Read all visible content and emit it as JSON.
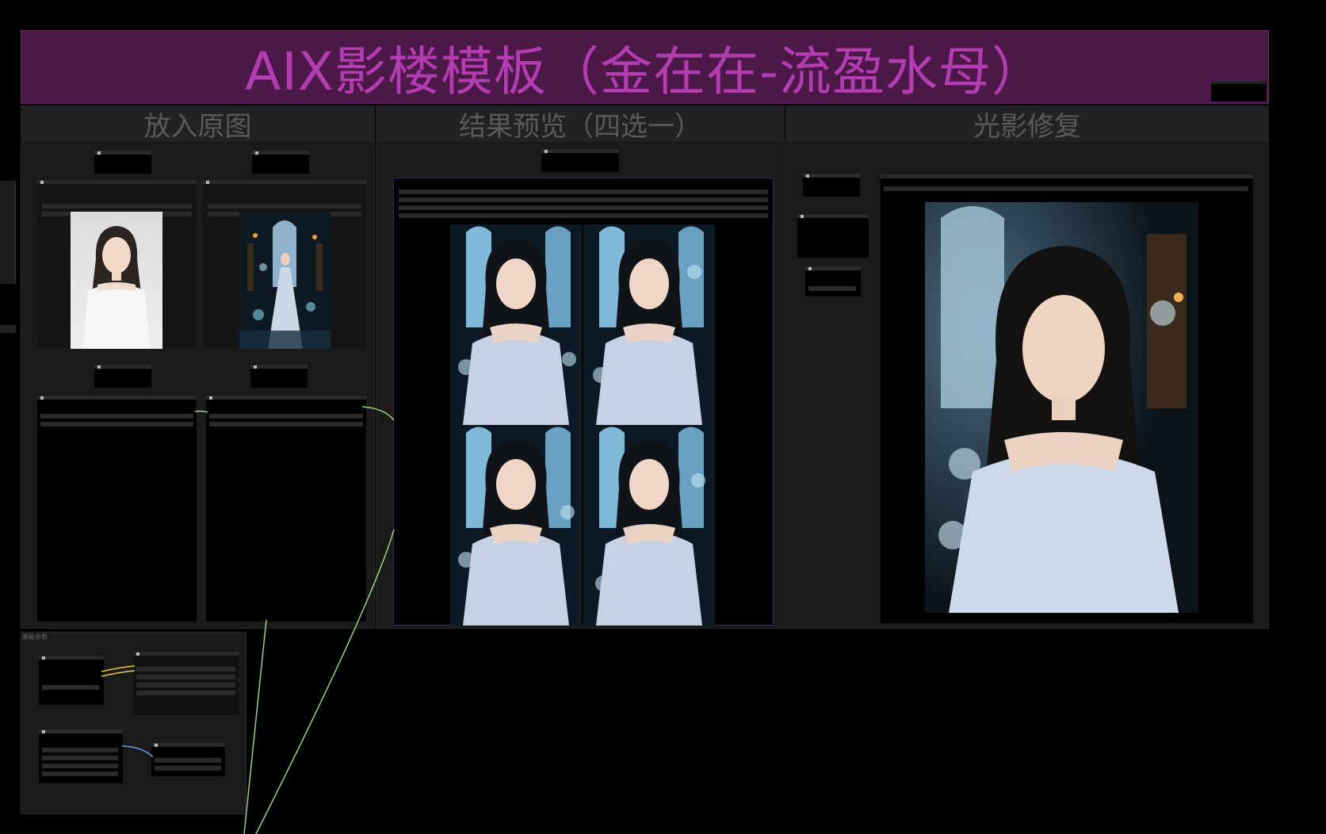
{
  "title": "AIX影楼模板（金在在-流盈水母）",
  "groups": {
    "original": "放入原图",
    "preview": "结果预览（四选一）",
    "relight": "光影修复",
    "params": "基础参数"
  },
  "colors": {
    "title_bg": "#4b1848",
    "title_text": "#b23cb0",
    "group_bg": "#1a1a1a",
    "link_green": "#9fd07a",
    "link_yellow": "#e6c84a",
    "link_blue": "#6aa0e0"
  }
}
